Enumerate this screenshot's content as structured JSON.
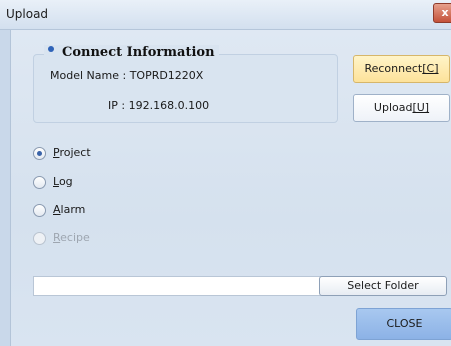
{
  "window": {
    "title": "Upload",
    "close_glyph": "x"
  },
  "connect_info": {
    "heading": "Connect Information",
    "model_label": "Model Name :",
    "model_value": "TOPRD1220X",
    "ip_label": "IP :",
    "ip_value": "192.168.0.100"
  },
  "buttons": {
    "reconnect_prefix": "Reconnect",
    "reconnect_key": "[C]",
    "upload_prefix": "Upload",
    "upload_key": "[U]",
    "select_folder": "Select Folder",
    "close": "CLOSE"
  },
  "options": [
    {
      "first": "P",
      "rest": "roject",
      "checked": true,
      "enabled": true
    },
    {
      "first": "L",
      "rest": "og",
      "checked": false,
      "enabled": true
    },
    {
      "first": "A",
      "rest": "larm",
      "checked": false,
      "enabled": true
    },
    {
      "first": "R",
      "rest": "ecipe",
      "checked": false,
      "enabled": false
    }
  ],
  "folder_path": {
    "value": ""
  },
  "icons": {
    "window_close": "close-icon",
    "info_bullet": "bullet-icon",
    "radio": "radio-icon"
  },
  "colors": {
    "client_bg": "#d9e4f0",
    "reconnect_bg": "#fde29a",
    "close_bg": "#8cb2e6",
    "title_close": "#c4523a"
  }
}
